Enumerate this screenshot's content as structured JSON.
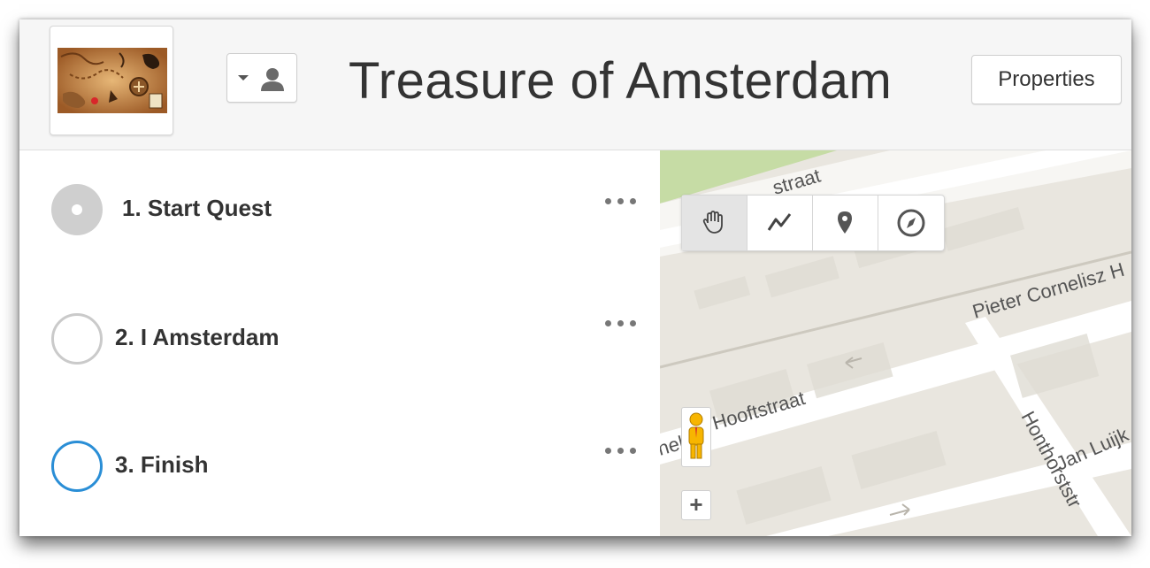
{
  "header": {
    "title": "Treasure of Amsterdam",
    "properties_label": "Properties",
    "thumbnail_icon": "treasure-map-thumbnail",
    "user_menu_icon": "user-icon"
  },
  "steps": [
    {
      "label": "1. Start Quest",
      "state": "active",
      "menu_icon": "more-icon"
    },
    {
      "label": "2. I Amsterdam",
      "state": "empty",
      "menu_icon": "more-icon"
    },
    {
      "label": "3. Finish",
      "state": "selected",
      "menu_icon": "more-icon"
    }
  ],
  "map": {
    "streets": {
      "top": "straat",
      "pieter": "Pieter Cornelisz H",
      "hooft": "Hooftstraat",
      "hooft_prefix": "nelis",
      "honthorst": "Honthorststr",
      "jan": "Jan Luijk"
    },
    "tools": [
      {
        "name": "hand-icon",
        "active": true
      },
      {
        "name": "route-icon",
        "active": false
      },
      {
        "name": "pin-icon",
        "active": false
      },
      {
        "name": "compass-icon",
        "active": false
      }
    ],
    "zoom_label": "+",
    "pegman_icon": "pegman-icon"
  },
  "colors": {
    "accent_blue": "#2a8ed6",
    "active_circle": "#cfcfcf",
    "map_bg": "#e9e6df",
    "park_green": "#c6dca5"
  }
}
